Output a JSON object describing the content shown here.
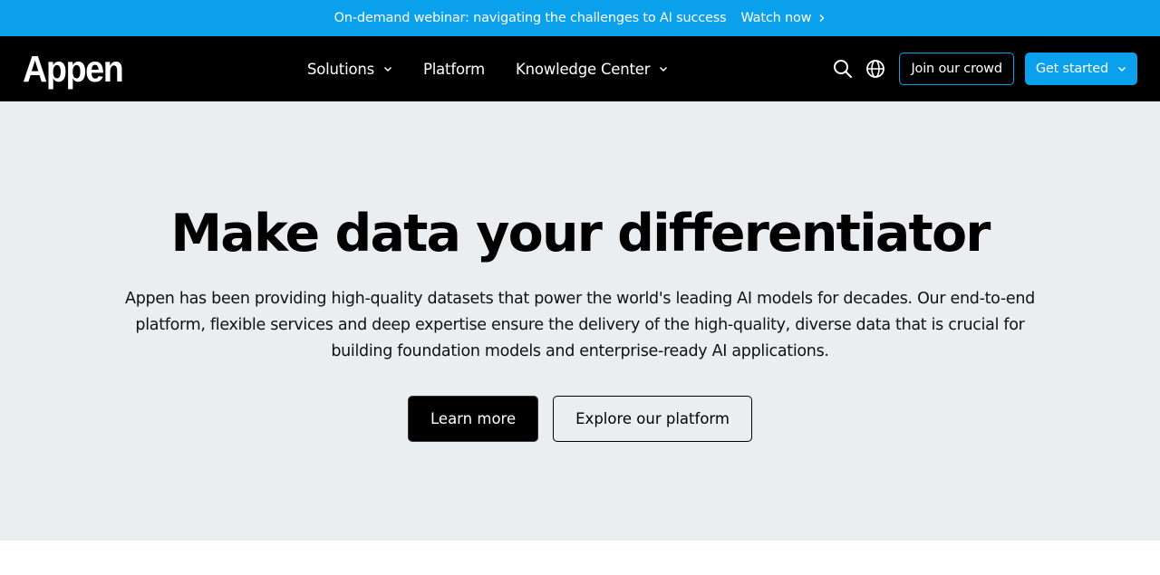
{
  "announcement": {
    "message": "On-demand webinar: navigating the challenges to AI success",
    "cta_label": "Watch now",
    "cta_icon": "chevron-right-icon"
  },
  "nav": {
    "logo_text": "Appen",
    "menu": [
      {
        "label": "Solutions",
        "has_dropdown": true
      },
      {
        "label": "Platform",
        "has_dropdown": false
      },
      {
        "label": "Knowledge Center",
        "has_dropdown": true
      }
    ],
    "icons": [
      "search-icon",
      "globe-icon"
    ],
    "join_label": "Join our crowd",
    "get_started_label": "Get started"
  },
  "hero": {
    "title": "Make data your differentiator",
    "description": "Appen has been providing high-quality datasets that power the world's leading AI models for decades. Our end-to-end platform, flexible services and deep expertise ensure the delivery of the high-quality, diverse data that is crucial for building foundation models and enterprise-ready AI applications.",
    "primary_button": "Learn more",
    "secondary_button": "Explore our platform"
  },
  "colors": {
    "accent": "#0aa0ec",
    "nav_bg": "#000000",
    "hero_bg": "#eaeef0"
  }
}
